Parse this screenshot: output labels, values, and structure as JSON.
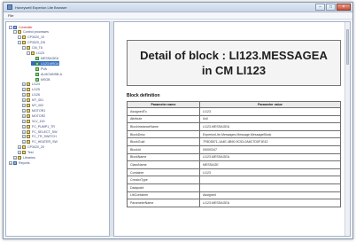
{
  "window": {
    "title": "Honeywell Experion Lite Browser",
    "buttons": [
      "–",
      "□",
      "×"
    ]
  },
  "menu": {
    "file": "File"
  },
  "tree": {
    "nodes": [
      {
        "label": "Controller",
        "level": 0,
        "toggle": "-",
        "icon": "blue",
        "red": true
      },
      {
        "label": "Control processes",
        "level": 1,
        "toggle": "-",
        "icon": "yellow"
      },
      {
        "label": "CP3020_10",
        "level": 2,
        "toggle": "-",
        "icon": "yellow"
      },
      {
        "label": "CP3020_DD",
        "level": 2,
        "toggle": "-",
        "icon": "yellow"
      },
      {
        "label": "CM_T8",
        "level": 3,
        "toggle": "-",
        "icon": "yellow"
      },
      {
        "label": "LI123",
        "level": 4,
        "toggle": "-",
        "icon": "yellow"
      },
      {
        "label": "MESSAGEA",
        "level": 5,
        "toggle": "",
        "icon": "green"
      },
      {
        "label": "LI123.MSGA",
        "level": 5,
        "toggle": "",
        "icon": "green",
        "selected": true
      },
      {
        "label": "PVA",
        "level": 5,
        "toggle": "",
        "icon": "green"
      },
      {
        "label": "ALMCMNSB-A",
        "level": 5,
        "toggle": "",
        "icon": "green"
      },
      {
        "label": "MSGB",
        "level": 5,
        "toggle": "",
        "icon": "green"
      },
      {
        "label": "LI124",
        "level": 3,
        "toggle": "+",
        "icon": "yellow"
      },
      {
        "label": "LI125",
        "level": 3,
        "toggle": "+",
        "icon": "yellow"
      },
      {
        "label": "LI126",
        "level": 3,
        "toggle": "+",
        "icon": "yellow"
      },
      {
        "label": "MT_001",
        "level": 3,
        "toggle": "+",
        "icon": "yellow"
      },
      {
        "label": "MT_002",
        "level": 3,
        "toggle": "+",
        "icon": "yellow"
      },
      {
        "label": "MOTOR1",
        "level": 3,
        "toggle": "+",
        "icon": "yellow"
      },
      {
        "label": "MOTOR2",
        "level": 3,
        "toggle": "+",
        "icon": "yellow"
      },
      {
        "label": "VLV_100",
        "level": 3,
        "toggle": "+",
        "icon": "yellow"
      },
      {
        "label": "FC_PUMP1_TR",
        "level": 3,
        "toggle": "+",
        "icon": "yellow"
      },
      {
        "label": "FC_SELECT_SW",
        "level": 3,
        "toggle": "+",
        "icon": "yellow"
      },
      {
        "label": "FC_TR_SWITCH",
        "level": 3,
        "toggle": "+",
        "icon": "yellow"
      },
      {
        "label": "FC_HEATER_SW",
        "level": 3,
        "toggle": "+",
        "icon": "yellow"
      },
      {
        "label": "CP3020_20",
        "level": 2,
        "toggle": "+",
        "icon": "yellow"
      },
      {
        "label": "Test",
        "level": 2,
        "toggle": "+",
        "icon": "yellow"
      },
      {
        "label": "Libraries",
        "level": 1,
        "toggle": "+",
        "icon": "yellow"
      },
      {
        "label": "Reports",
        "level": 0,
        "toggle": "+",
        "icon": "blue"
      }
    ]
  },
  "detail": {
    "title": "Detail of block : LI123.MESSAGEA in CM LI123",
    "section": "Block definition",
    "columns": [
      "Parameter name",
      "Parameter value"
    ],
    "rows": [
      [
        "AssignedTo",
        "LI123"
      ],
      [
        "Attribute",
        "0x0"
      ],
      [
        "BlockInstanceName",
        "LI123.MESSAGEA"
      ],
      [
        "BlockDesc",
        "ExperionLite.Messages.Message.MessageBlock"
      ],
      [
        "BlockGuid",
        "7F8D5571-1A4E-4B90-9C53-0A8C7D0F1E42"
      ],
      [
        "BlockId",
        "00000347"
      ],
      [
        "BlockName",
        "LI123.MESSAGEA"
      ],
      [
        "ClassName",
        "MESSAGE"
      ],
      [
        "Container",
        "LI123"
      ],
      [
        "CreatorType",
        ""
      ],
      [
        "Datapoint",
        ""
      ],
      [
        "LibContainer",
        "Assigned"
      ],
      [
        "ParameterName",
        "LI123.MESSAGEA"
      ]
    ]
  },
  "colors": {
    "selection": "#2f6ebf",
    "tree_text": "#3a4a7a"
  }
}
